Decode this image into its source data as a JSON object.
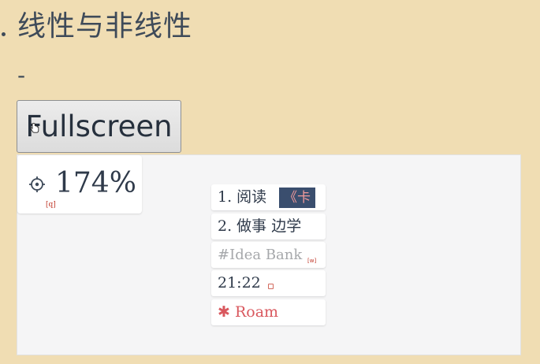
{
  "heading": {
    "title": "线性与非线性"
  },
  "dash": "-",
  "fullscreen_button": {
    "label": "Fullscreen"
  },
  "zoom": {
    "value": "174%",
    "shortcut": "[q]"
  },
  "cards": [
    {
      "text": "1. 阅读",
      "tag": "《卡"
    },
    {
      "text": "2. 做事 边学"
    },
    {
      "text": "#Idea Bank",
      "mark": "[w]"
    },
    {
      "text": "21:22"
    },
    {
      "text": "✱ Roam"
    }
  ],
  "colors": {
    "background": "#f0ddb3",
    "panel": "#f5f5f6",
    "text": "#3e4a59",
    "accent_red": "#d9585e",
    "tag_bg": "#3a4e6e"
  },
  "icons": {
    "zoom": "crosshair-icon",
    "cursor": "hand-cursor-icon",
    "check": "checkbox-icon"
  }
}
